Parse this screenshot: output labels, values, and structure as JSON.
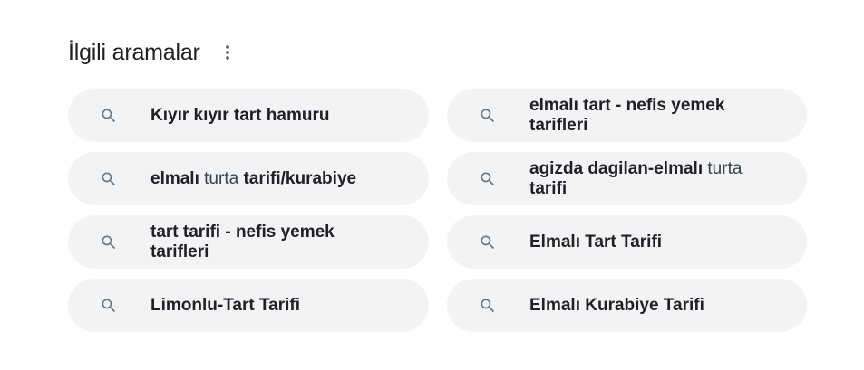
{
  "related": {
    "title": "İlgili aramalar",
    "more_icon": "more-vert-icon",
    "search_icon": "search-icon",
    "items": [
      {
        "segments": [
          {
            "text": "Kıyır kıyır tart hamuru",
            "bold": true
          }
        ]
      },
      {
        "segments": [
          {
            "text": "elmalı tart - nefis yemek tarifleri",
            "bold": true
          }
        ]
      },
      {
        "segments": [
          {
            "text": "elmalı ",
            "bold": true
          },
          {
            "text": "turta ",
            "bold": false
          },
          {
            "text": "tarifi/kurabiye",
            "bold": true
          }
        ]
      },
      {
        "segments": [
          {
            "text": "agizda dagilan-elmalı ",
            "bold": true
          },
          {
            "text": "turta ",
            "bold": false
          },
          {
            "text": "tarifi",
            "bold": true
          }
        ]
      },
      {
        "segments": [
          {
            "text": "tart tarifi - nefis yemek tarifleri",
            "bold": true
          }
        ]
      },
      {
        "segments": [
          {
            "text": "Elmalı Tart Tarifi",
            "bold": true
          }
        ]
      },
      {
        "segments": [
          {
            "text": "Limonlu-Tart Tarifi",
            "bold": true
          }
        ]
      },
      {
        "segments": [
          {
            "text": "Elmalı Kurabiye Tarifi",
            "bold": true
          }
        ]
      }
    ]
  }
}
